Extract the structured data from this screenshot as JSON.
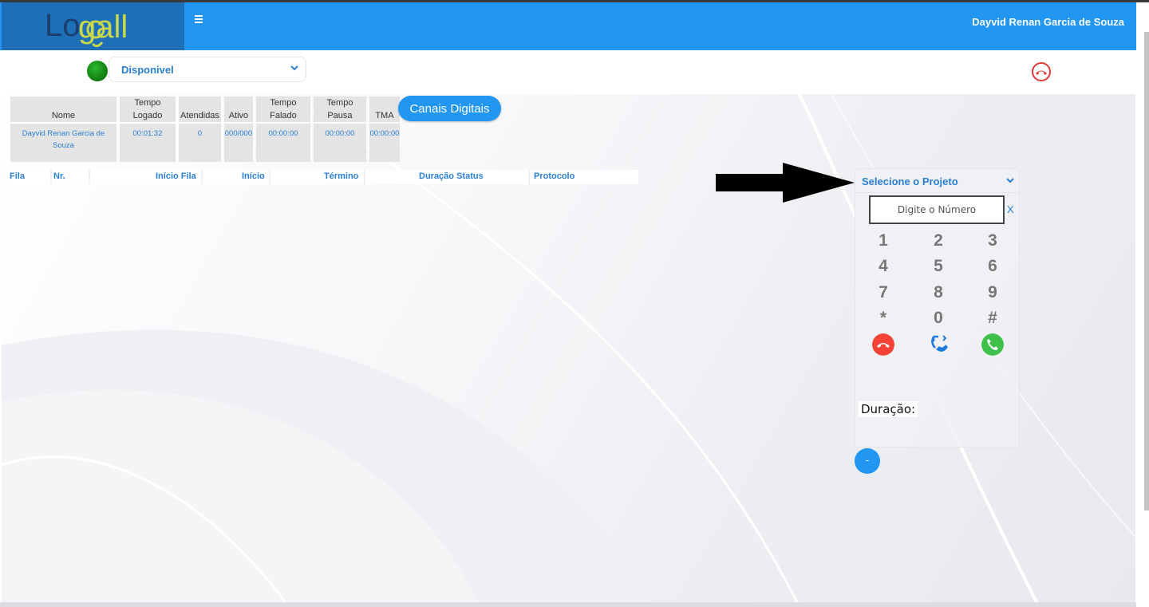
{
  "header": {
    "logo_text_lo": "Lo",
    "logo_text_gall": "gall",
    "menu_icon": "hamburger-icon",
    "user_name": "Dayvid Renan Garcia de Souza",
    "background_color": "#2196f3",
    "logo_background_color": "#1d6fb8"
  },
  "status": {
    "indicator_color": "#1a961a",
    "selected": "Disponivel"
  },
  "agent_table": {
    "headers": [
      "Nome",
      "Tempo Logado",
      "Atendidas",
      "Ativo",
      "Tempo Falado",
      "Tempo Pausa",
      "TMA"
    ],
    "row": [
      "Dayvid Renan Garcia de Souza",
      "00:01:32",
      "0",
      "000/000",
      "00:00:00",
      "00:00:00",
      "00:00:00"
    ]
  },
  "canais_button": "Canais Digitais",
  "queue_table": {
    "headers": [
      "Fila",
      "Nr.",
      "Início Fila",
      "Início",
      "Término",
      "Duração Status",
      "Protocolo"
    ]
  },
  "dialer": {
    "project_select": "Selecione o Projeto",
    "number_placeholder": "Digite o Número",
    "clear_label": "X",
    "keys": [
      "1",
      "2",
      "3",
      "4",
      "5",
      "6",
      "7",
      "8",
      "9",
      "*",
      "0",
      "#"
    ],
    "hangup_color": "#f44336",
    "transfer_color": "#1f7be0",
    "call_color": "#3fc04a",
    "duration_label": "Duração:",
    "minimize_label": "-"
  }
}
